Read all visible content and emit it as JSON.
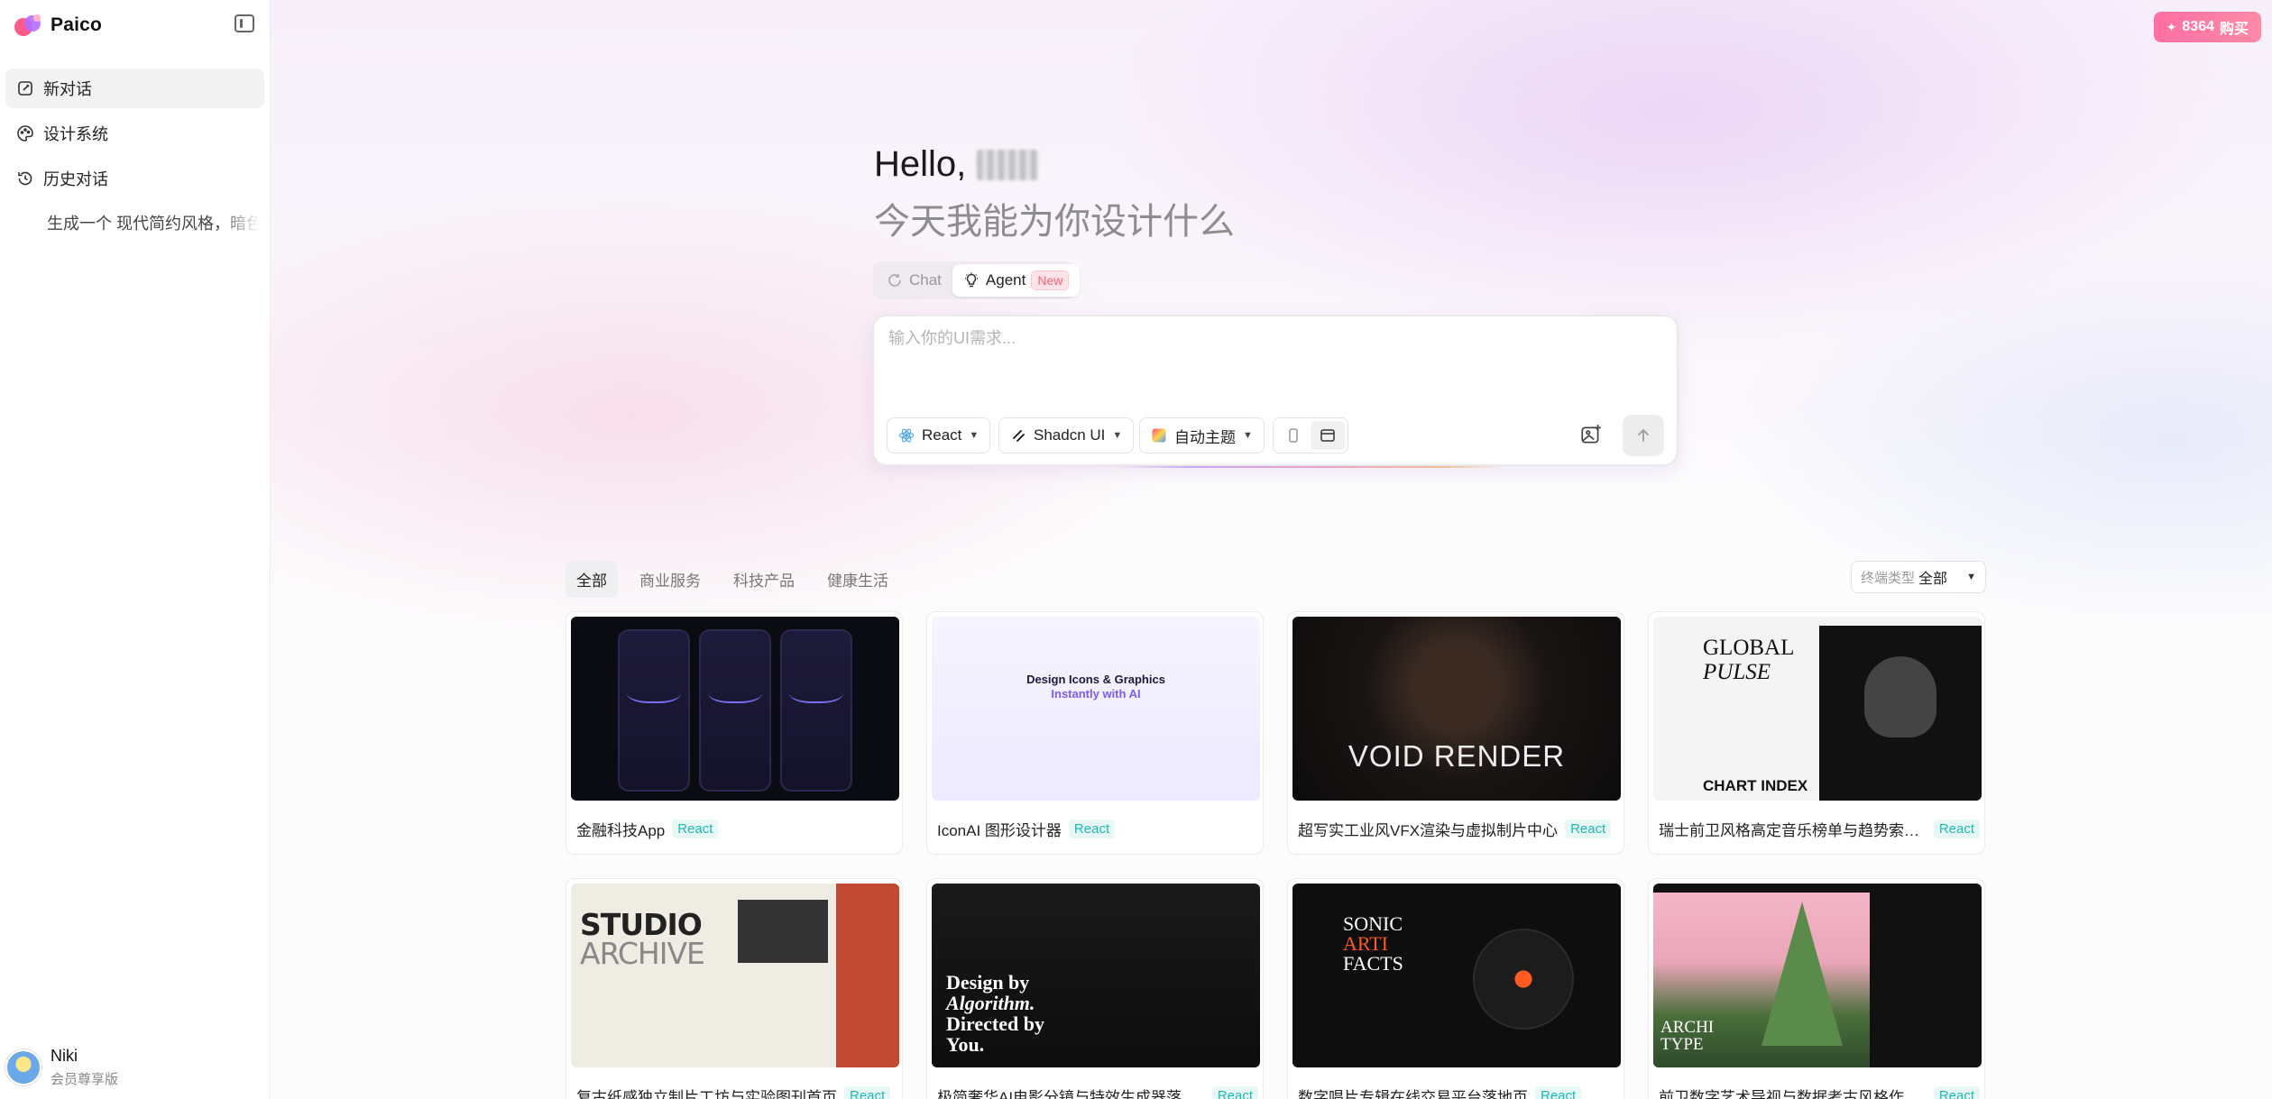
{
  "brand": {
    "name": "Paico"
  },
  "nav": {
    "items": [
      {
        "label": "新对话",
        "icon": "edit-icon"
      },
      {
        "label": "设计系统",
        "icon": "palette-icon"
      },
      {
        "label": "历史对话",
        "icon": "history-icon"
      }
    ],
    "history": [
      "生成一个 现代简约风格，暗色"
    ]
  },
  "user": {
    "name": "Niki",
    "tier": "会员尊享版"
  },
  "header": {
    "credits": "8364",
    "buy_label": "购买"
  },
  "hero": {
    "greeting": "Hello,",
    "subtitle": "今天我能为你设计什么"
  },
  "modes": {
    "chat": "Chat",
    "agent": "Agent",
    "agent_badge": "New"
  },
  "composer": {
    "placeholder": "输入你的UI需求...",
    "framework": "React",
    "library": "Shadcn UI",
    "theme": "自动主题"
  },
  "filters": {
    "tabs": [
      "全部",
      "商业服务",
      "科技产品",
      "健康生活"
    ],
    "type_label": "终端类型",
    "type_value": "全部"
  },
  "cards": [
    {
      "title": "金融科技App",
      "tag": "React"
    },
    {
      "title": "IconAI 图形设计器",
      "tag": "React",
      "thumb_line1": "Design Icons & Graphics",
      "thumb_line2": "Instantly with AI"
    },
    {
      "title": "超写实工业风VFX渲染与虚拟制片中心",
      "tag": "React",
      "thumb_text": "VOID RENDER"
    },
    {
      "title": "瑞士前卫风格高定音乐榜单与趋势索引...",
      "tag": "React",
      "thumb_line1": "GLOBAL",
      "thumb_line2": "PULSE",
      "thumb_line3": "CHART INDEX"
    },
    {
      "title": "复古纸感独立制片工坊与实验图刊首页",
      "tag": "React",
      "thumb_line1": "STUDIO",
      "thumb_line2": "ARCHIVE"
    },
    {
      "title": "极简奢华AI电影分镜与特效生成器落地页",
      "tag": "React",
      "thumb_line1": "Design by",
      "thumb_line2": "Algorithm.",
      "thumb_line3": "Directed by",
      "thumb_line4": "You."
    },
    {
      "title": "数字唱片专辑在线交易平台落地页",
      "tag": "React",
      "thumb_line1": "SONIC",
      "thumb_line2": "ARTI",
      "thumb_line3": "FACTS"
    },
    {
      "title": "前卫数字艺术导视与数据考古风格作品...",
      "tag": "React",
      "thumb_line1": "ARCHI",
      "thumb_line2": "TYPE"
    }
  ]
}
